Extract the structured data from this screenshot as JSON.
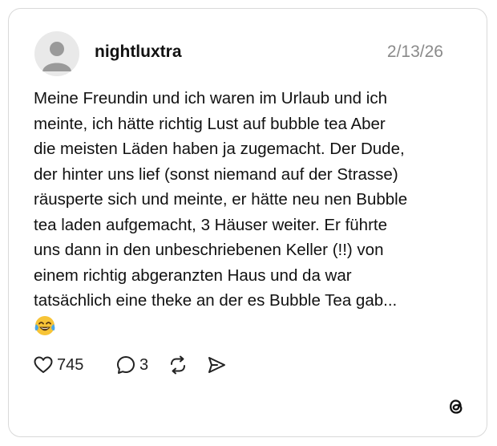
{
  "post": {
    "username": "nightluxtra",
    "date": "2/13/26",
    "text_lines": [
      "Meine Freundin und ich waren im Urlaub und ich",
      "meinte, ich hätte richtig Lust auf bubble tea Aber",
      "die meisten Läden haben ja zugemacht. Der Dude,",
      "der hinter uns lief (sonst niemand auf der Strasse)",
      "räusperte sich und meinte, er hätte neu nen Bubble",
      "tea laden aufgemacht, 3 Häuser weiter. Er führte",
      "uns dann in den unbeschriebenen Keller (!!) von",
      "einem richtig abgeranzten Haus und da war",
      "tatsächlich eine theke an der es Bubble Tea gab..."
    ],
    "emoji": "face-with-tears-of-joy-icon"
  },
  "actions": {
    "likes": "745",
    "replies": "3",
    "icons": [
      "heart-icon",
      "comment-icon",
      "repost-icon",
      "share-icon"
    ]
  },
  "branding": {
    "logo": "threads-logo-icon"
  },
  "colors": {
    "text": "#111111",
    "muted": "#8a8a8a",
    "border": "#d9d9d9",
    "avatar_bg": "#e9e9e9",
    "avatar_fg": "#9a9a9a",
    "emoji_face": "#f7c437"
  }
}
